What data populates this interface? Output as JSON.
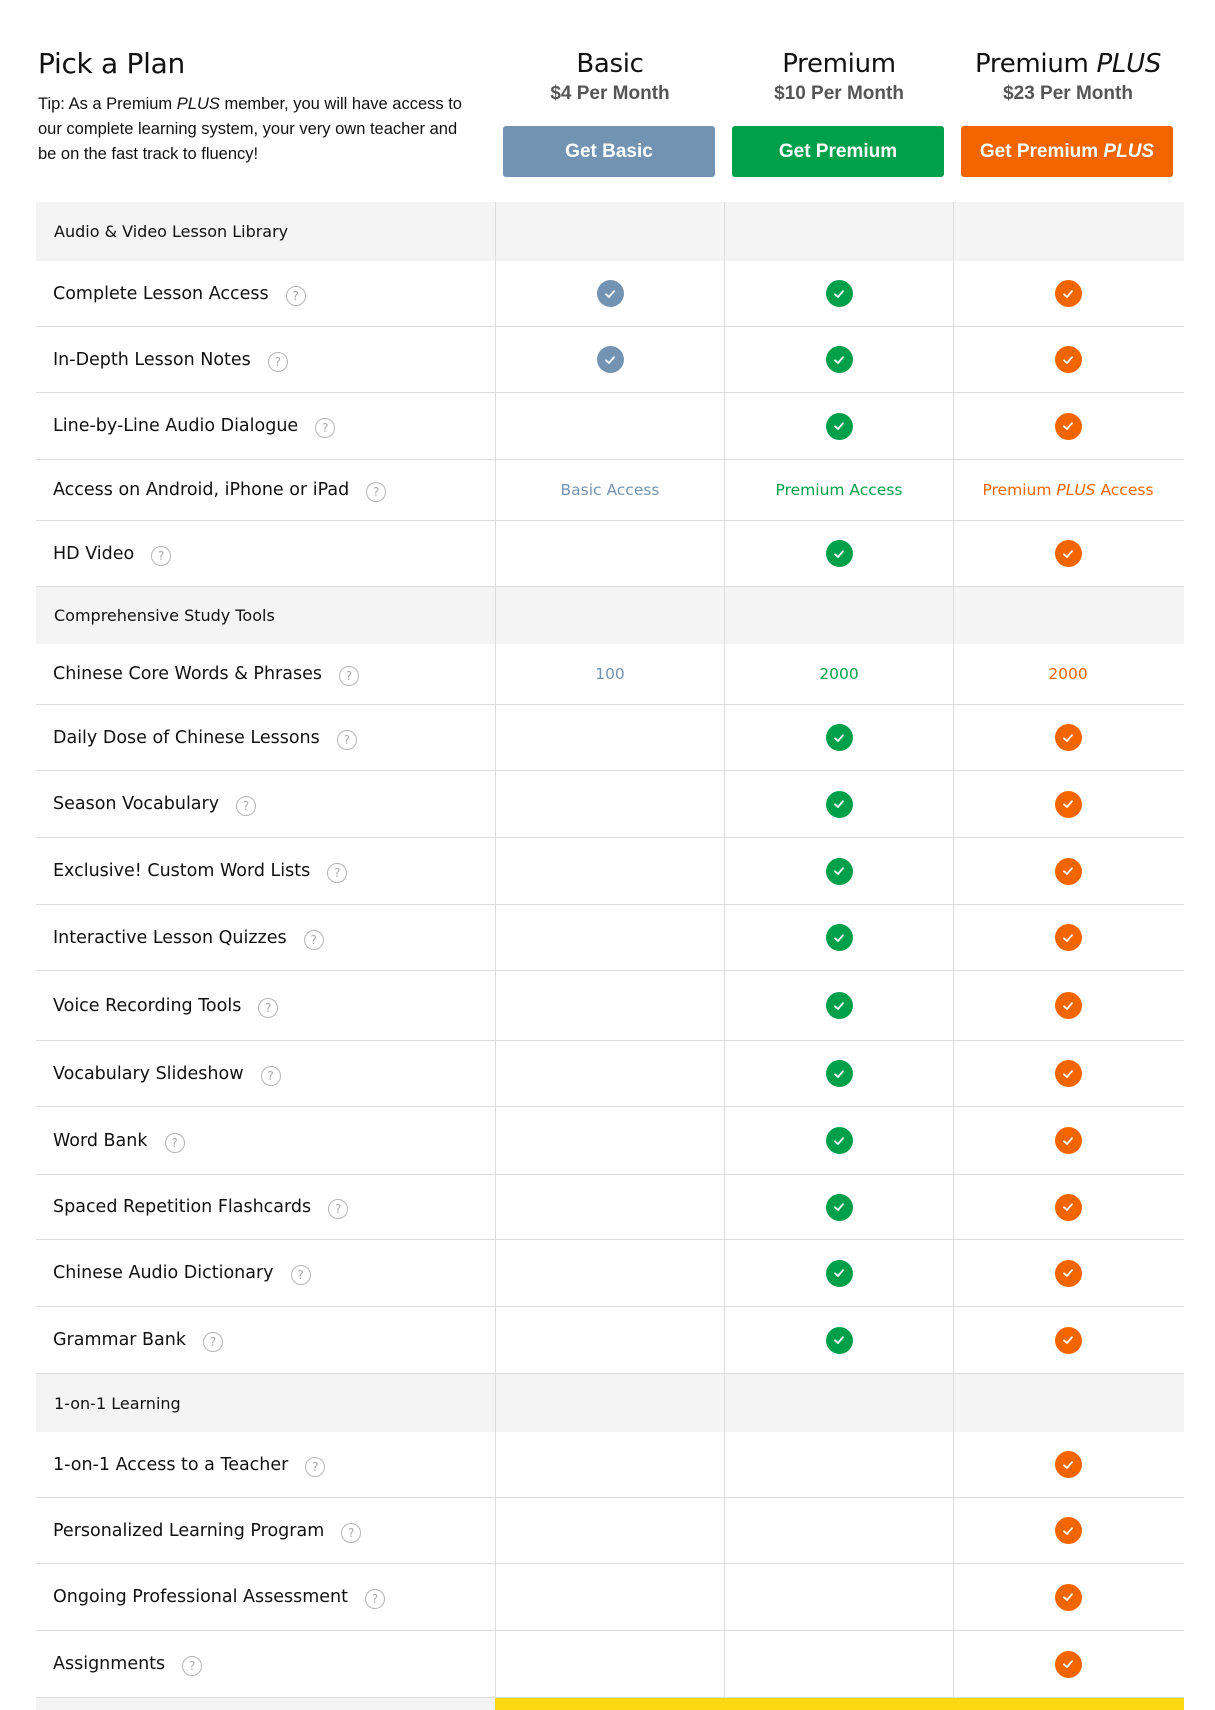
{
  "header": {
    "title": "Pick a Plan",
    "tip_prefix": "Tip: As a Premium ",
    "tip_em": "PLUS",
    "tip_suffix": " member, you will have access to our complete learning system, your very own teacher and be on the fast track to fluency!"
  },
  "colors": {
    "basic": "#7393b3",
    "premium": "#00a04a",
    "plus": "#f26500",
    "section_bg": "#f4f4f4",
    "footer_accent": "#fcd913"
  },
  "plans": [
    {
      "id": "basic",
      "name": "Basic",
      "name_em": "",
      "price": "$4 Per Month",
      "button": "Get Basic",
      "button_em": ""
    },
    {
      "id": "premium",
      "name": "Premium",
      "name_em": "",
      "price": "$10 Per Month",
      "button": "Get Premium",
      "button_em": ""
    },
    {
      "id": "plus",
      "name": "Premium ",
      "name_em": "PLUS",
      "price": "$23 Per Month",
      "button": "Get Premium ",
      "button_em": "PLUS"
    }
  ],
  "help_icon": "?",
  "rows": [
    {
      "type": "section",
      "label": "Audio & Video Lesson Library",
      "h": 59
    },
    {
      "type": "feature",
      "label": "Complete Lesson Access",
      "values": [
        "check",
        "check",
        "check"
      ],
      "h": 66
    },
    {
      "type": "feature",
      "label": "In-Depth Lesson Notes",
      "values": [
        "check",
        "check",
        "check"
      ],
      "h": 66
    },
    {
      "type": "feature",
      "label": "Line-by-Line Audio Dialogue",
      "values": [
        "",
        "check",
        "check"
      ],
      "h": 67
    },
    {
      "type": "feature",
      "label": "Access on Android, iPhone or iPad",
      "values": [
        {
          "text": "Basic Access"
        },
        {
          "text": "Premium Access"
        },
        {
          "text": "Premium ",
          "em": "PLUS",
          "after": " Access"
        }
      ],
      "h": 61
    },
    {
      "type": "feature",
      "label": "HD Video",
      "values": [
        "",
        "check",
        "check"
      ],
      "h": 66
    },
    {
      "type": "section",
      "label": "Comprehensive Study Tools",
      "h": 57
    },
    {
      "type": "feature",
      "label": "Chinese Core Words & Phrases",
      "values": [
        {
          "text": "100"
        },
        {
          "text": "2000"
        },
        {
          "text": "2000"
        }
      ],
      "h": 61
    },
    {
      "type": "feature",
      "label": "Daily Dose of Chinese Lessons",
      "values": [
        "",
        "check",
        "check"
      ],
      "h": 66
    },
    {
      "type": "feature",
      "label": "Season Vocabulary",
      "values": [
        "",
        "check",
        "check"
      ],
      "h": 67
    },
    {
      "type": "feature",
      "label": "Exclusive! Custom Word Lists",
      "values": [
        "",
        "check",
        "check"
      ],
      "h": 67
    },
    {
      "type": "feature",
      "label": "Interactive Lesson Quizzes",
      "values": [
        "",
        "check",
        "check"
      ],
      "h": 66
    },
    {
      "type": "feature",
      "label": "Voice Recording Tools",
      "values": [
        "",
        "check",
        "check"
      ],
      "h": 70
    },
    {
      "type": "feature",
      "label": "Vocabulary Slideshow",
      "values": [
        "",
        "check",
        "check"
      ],
      "h": 66
    },
    {
      "type": "feature",
      "label": "Word Bank",
      "values": [
        "",
        "check",
        "check"
      ],
      "h": 68
    },
    {
      "type": "feature",
      "label": "Spaced Repetition Flashcards",
      "values": [
        "",
        "check",
        "check"
      ],
      "h": 65
    },
    {
      "type": "feature",
      "label": "Chinese Audio Dictionary",
      "values": [
        "",
        "check",
        "check"
      ],
      "h": 67
    },
    {
      "type": "feature",
      "label": "Grammar Bank",
      "values": [
        "",
        "check",
        "check"
      ],
      "h": 67
    },
    {
      "type": "section",
      "label": "1-on-1 Learning",
      "h": 58
    },
    {
      "type": "feature",
      "label": "1-on-1 Access to a Teacher",
      "values": [
        "",
        "",
        "check"
      ],
      "h": 66
    },
    {
      "type": "feature",
      "label": "Personalized Learning Program",
      "values": [
        "",
        "",
        "check"
      ],
      "h": 66
    },
    {
      "type": "feature",
      "label": "Ongoing Professional Assessment",
      "values": [
        "",
        "",
        "check"
      ],
      "h": 67
    },
    {
      "type": "feature",
      "label": "Assignments",
      "values": [
        "",
        "",
        "check"
      ],
      "h": 67
    }
  ]
}
